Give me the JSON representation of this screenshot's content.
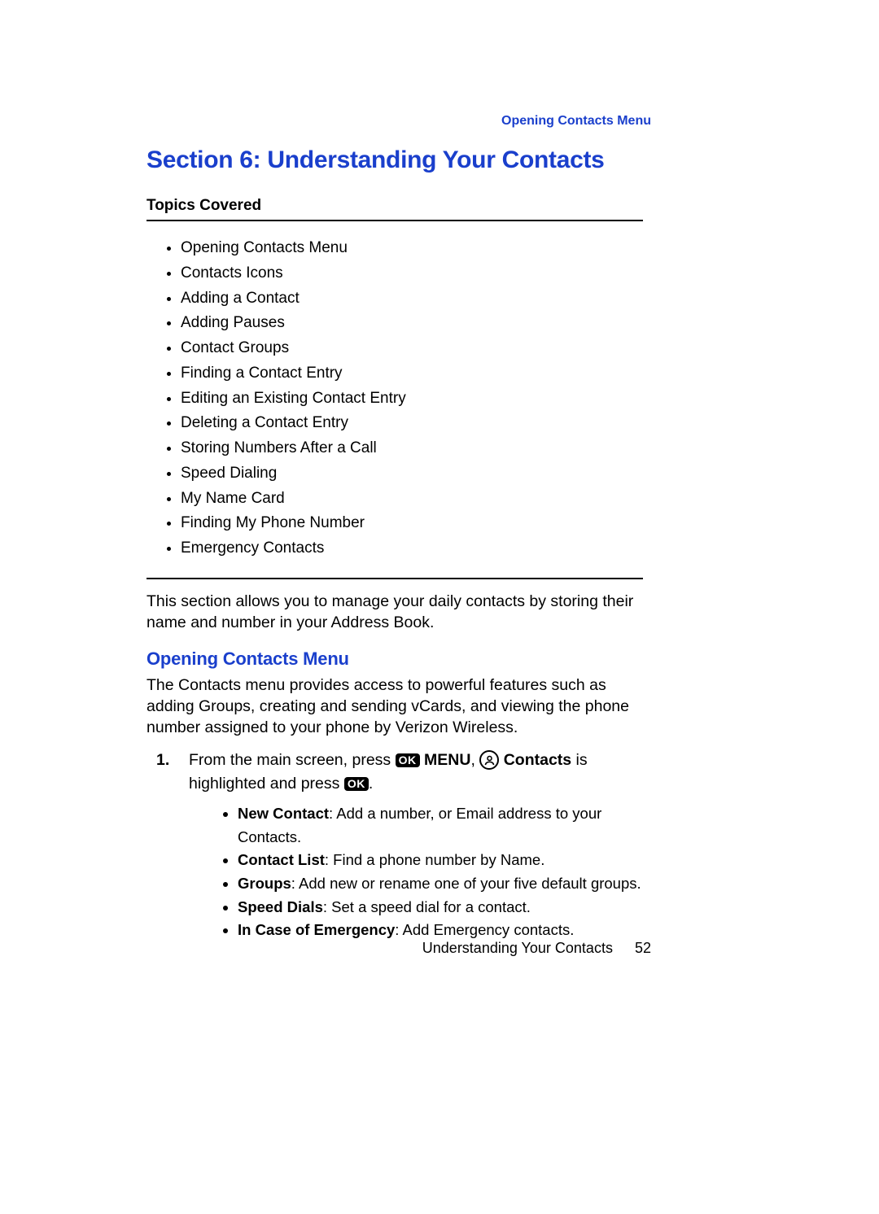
{
  "header": {
    "running": "Opening Contacts Menu"
  },
  "title": "Section 6: Understanding Your Contacts",
  "topics": {
    "label": "Topics Covered",
    "items": [
      "Opening Contacts Menu",
      "Contacts Icons",
      "Adding a Contact",
      "Adding Pauses",
      "Contact Groups",
      "Finding a Contact Entry",
      "Editing an Existing Contact Entry",
      "Deleting a Contact Entry",
      "Storing Numbers After a Call",
      "Speed Dialing",
      "My Name Card",
      "Finding My Phone Number",
      "Emergency Contacts"
    ]
  },
  "intro": "This section allows you to manage your daily contacts by storing their name and number in your Address Book.",
  "subsection": {
    "heading": "Opening Contacts Menu",
    "para": "The Contacts menu provides access to powerful features such as adding Groups, creating and sending vCards, and viewing the phone number assigned to your phone by Verizon Wireless.",
    "step1": {
      "num": "1.",
      "pre": "From the main screen, press ",
      "ok_label": "OK",
      "menu_bold": " MENU",
      "comma": ", ",
      "contacts_icon_name": "contacts-icon",
      "contacts_bold": " Contacts",
      "mid": " is highlighted and press ",
      "ok_label2": "OK",
      "period": "."
    },
    "subitems": [
      {
        "term": "New Contact",
        "desc": ": Add a number, or Email address to your Contacts."
      },
      {
        "term": "Contact List",
        "desc": ": Find a phone number by Name."
      },
      {
        "term": "Groups",
        "desc": ": Add new or rename one of your five default groups."
      },
      {
        "term": "Speed Dials",
        "desc": ": Set a speed dial for a contact."
      },
      {
        "term": "In Case of Emergency",
        "desc": ": Add Emergency contacts."
      }
    ]
  },
  "footer": {
    "text": "Understanding Your Contacts",
    "page": "52"
  }
}
